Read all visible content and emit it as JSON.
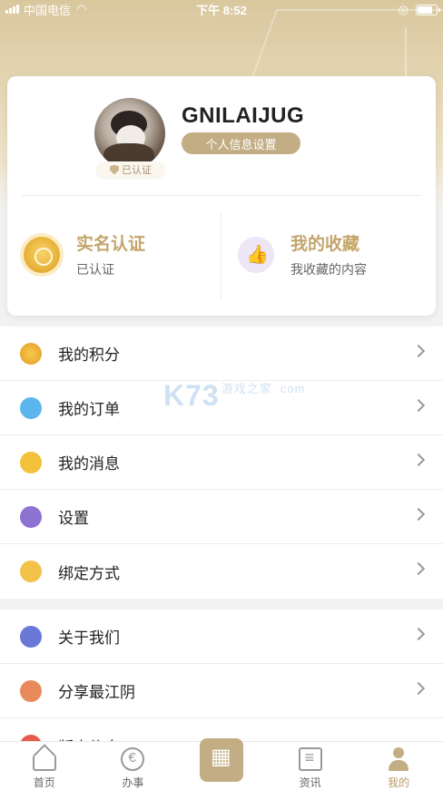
{
  "status_bar": {
    "carrier": "中国电信",
    "time": "下午 8:52"
  },
  "profile": {
    "username": "GNILAIJUG",
    "settings_label": "个人信息设置",
    "verified_label": "已认证"
  },
  "features": [
    {
      "title": "实名认证",
      "subtitle": "已认证",
      "icon": "gold-medal-icon"
    },
    {
      "title": "我的收藏",
      "subtitle": "我收藏的内容",
      "icon": "thumbs-up-icon"
    }
  ],
  "menu_group_1": [
    {
      "label": "我的积分",
      "icon": "points-icon"
    },
    {
      "label": "我的订单",
      "icon": "orders-icon"
    },
    {
      "label": "我的消息",
      "icon": "message-icon"
    },
    {
      "label": "设置",
      "icon": "settings-icon"
    },
    {
      "label": "绑定方式",
      "icon": "bind-icon"
    }
  ],
  "menu_group_2": [
    {
      "label": "关于我们",
      "icon": "about-icon"
    },
    {
      "label": "分享最江阴",
      "icon": "share-icon"
    },
    {
      "label": "版本信息",
      "icon": "version-icon"
    }
  ],
  "watermark": {
    "main": "K73",
    "sub": "游戏之家 .com"
  },
  "tabs": [
    {
      "label": "首页",
      "icon": "home-icon"
    },
    {
      "label": "办事",
      "icon": "service-icon"
    },
    {
      "label": "",
      "icon": "qr-scan-icon"
    },
    {
      "label": "资讯",
      "icon": "news-icon"
    },
    {
      "label": "我的",
      "icon": "user-icon"
    }
  ],
  "colors": {
    "accent": "#c2ad84",
    "gold_text": "#c3a56b"
  }
}
